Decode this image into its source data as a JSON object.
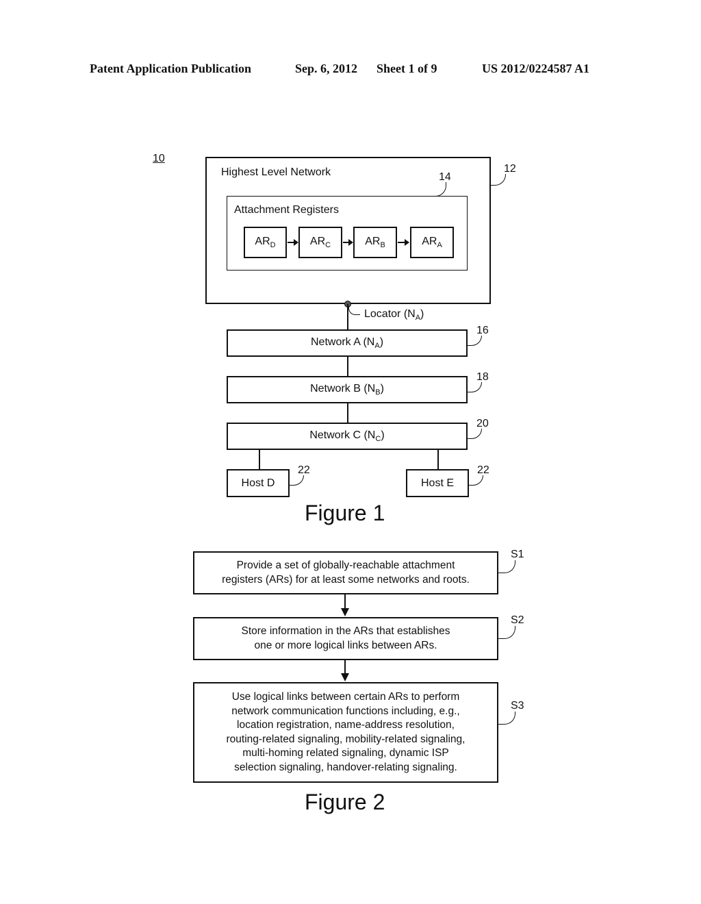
{
  "header": {
    "publication": "Patent Application Publication",
    "date": "Sep. 6, 2012",
    "sheet": "Sheet 1 of 9",
    "number": "US 2012/0224587 A1"
  },
  "figure1": {
    "system_ref": "10",
    "highest_network": {
      "label": "Highest Level Network",
      "ref": "12"
    },
    "attachment_registers": {
      "label": "Attachment Registers",
      "ref": "14",
      "registers": [
        {
          "base": "AR",
          "sub": "D"
        },
        {
          "base": "AR",
          "sub": "C"
        },
        {
          "base": "AR",
          "sub": "B"
        },
        {
          "base": "AR",
          "sub": "A"
        }
      ]
    },
    "locator": {
      "text": "Locator (N",
      "sub": "A",
      "close": ")"
    },
    "networks": [
      {
        "text": "Network A (N",
        "sub": "A",
        "close": ")",
        "ref": "16"
      },
      {
        "text": "Network B (N",
        "sub": "B",
        "close": ")",
        "ref": "18"
      },
      {
        "text": "Network C (N",
        "sub": "C",
        "close": ")",
        "ref": "20"
      }
    ],
    "hosts": [
      {
        "label": "Host D",
        "ref": "22"
      },
      {
        "label": "Host E",
        "ref": "22"
      }
    ],
    "caption": "Figure 1"
  },
  "figure2": {
    "steps": [
      {
        "ref": "S1",
        "lines": [
          "Provide a set of globally-reachable attachment",
          "registers (ARs) for at least some networks and roots."
        ]
      },
      {
        "ref": "S2",
        "lines": [
          "Store information in the ARs that establishes",
          "one or more logical links between ARs."
        ]
      },
      {
        "ref": "S3",
        "lines": [
          "Use logical links between certain ARs to perform",
          "network communication functions including, e.g.,",
          "location registration, name-address resolution,",
          "routing-related signaling, mobility-related signaling,",
          "multi-homing related signaling, dynamic ISP",
          "selection signaling, handover-relating signaling."
        ]
      }
    ],
    "caption": "Figure 2"
  }
}
